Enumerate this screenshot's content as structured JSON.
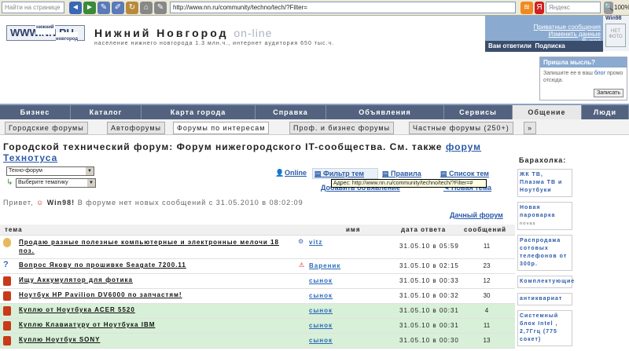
{
  "browser": {
    "search_placeholder": "Найти на странице",
    "url": "http://www.nn.ru/community/techno/tech/?Filter=",
    "search2_placeholder": "Яндекс",
    "zoom": "100%"
  },
  "header": {
    "logo_small": "нижний",
    "logo_text": "WWW.NN.RU",
    "logo_sub": "новгород",
    "city": "Нижний Новгород",
    "city_suffix": "on-line",
    "population": "население нижнего новгорода 1.3 млн.ч., интернет аудитория 650 тыс.ч.",
    "private_messages": "Приватные сообщения",
    "change_data": "Изменить данные",
    "logout": "Выход",
    "answered": "Вам ответили",
    "subscription": "Подписка",
    "username": "Win98",
    "no_photo": "НЕТ ФОТО"
  },
  "thought": {
    "title": "Пришла мысль?",
    "text_a": "Запишите ее в ваш",
    "link": "блог",
    "text_b": "промо отсюда.",
    "button": "Записать"
  },
  "main_nav": [
    "Бизнес",
    "Каталог",
    "Карта города",
    "Справка",
    "Объявления",
    "Сервисы",
    "Общение",
    "Люди"
  ],
  "sub_nav": [
    "Городские форумы",
    "Автофорумы",
    "Форумы по интересам",
    "Проф. и бизнес форумы",
    "Частные форумы (250+)",
    "»"
  ],
  "page_title": "Городской технический форум: Форум нижегородского IT-сообщества. См. также",
  "page_title_link": "форум Технотуса",
  "controls": {
    "select1": "Техно-форум",
    "select2": "Выберите тематику",
    "online": "Online",
    "filter": "Фильтр тем",
    "rules": "Правила",
    "topic_list": "Список тем",
    "add_ad": "Добавить объявление",
    "new_topic": "Новая тема",
    "tooltip": "Адрес: http://www.nn.ru/community/techno/tech/?Filter=#",
    "dacha": "Дачный форум"
  },
  "greeting": {
    "hello": "Привет,",
    "user": "Win98!",
    "msg": "В форуме нет новых сообщений с",
    "date": "31.05.2010 в 08:02:09"
  },
  "table": {
    "headers": {
      "topic": "тема",
      "name": "имя",
      "date": "дата ответа",
      "count": "сообщений"
    },
    "rows": [
      {
        "title": "Продаю разные полезные компьютерные и электронные мелочи 18 поз.",
        "author": "vitz",
        "date": "31.05.10 в 05:59",
        "count": "11",
        "icon": "hand",
        "green": false
      },
      {
        "title": "Вопрос Якову по прошивке Seagate 7200.11",
        "author": "Вареник",
        "date": "31.05.10 в 02:15",
        "count": "23",
        "icon": "question",
        "green": false
      },
      {
        "title": "Ищу Аккумулятор для фотика",
        "author": "сынок",
        "date": "31.05.10 в 00:33",
        "count": "12",
        "icon": "red",
        "green": false
      },
      {
        "title": "Ноутбук HP Pavilion DV6000 по запчастям!",
        "author": "сынок",
        "date": "31.05.10 в 00:32",
        "count": "30",
        "icon": "red",
        "green": false
      },
      {
        "title": "Куплю от Ноутбука ACER 5520",
        "author": "сынок",
        "date": "31.05.10 в 00:31",
        "count": "4",
        "icon": "red",
        "green": true
      },
      {
        "title": "Куплю Клавиатуру от Ноутбука IBM",
        "author": "сынок",
        "date": "31.05.10 в 00:31",
        "count": "11",
        "icon": "red",
        "green": true
      },
      {
        "title": "Куплю Ноутбук SONY",
        "author": "сынок",
        "date": "31.05.10 в 00:30",
        "count": "13",
        "icon": "red",
        "green": true
      }
    ]
  },
  "sidebar": {
    "title": "Барахолка:",
    "items": [
      {
        "t": "ЖК ТВ, Плазма ТВ и Ноутбуки"
      },
      {
        "t": "Новая пароварка",
        "s": "novas"
      },
      {
        "t": "Распродажа сотовых телефонов от 300р."
      },
      {
        "t": "Комплектующие"
      },
      {
        "t": "антиквариат"
      },
      {
        "t": "Системный блок Intel , 2,7Ггц (775 сокет)"
      }
    ]
  },
  "colors": {
    "nav": "#53627f",
    "accent": "#8aaad0",
    "green_row": "#d8f0d8",
    "link": "#2a5aa8"
  }
}
